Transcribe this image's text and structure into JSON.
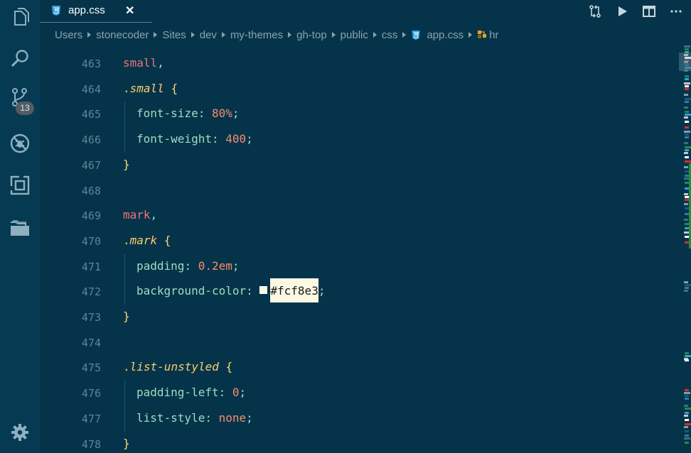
{
  "tabs": [
    {
      "label": "app.css",
      "close": "✕",
      "icon": "css3-icon"
    }
  ],
  "tab_actions": [
    "compare-changes-icon",
    "run-icon",
    "split-editor-icon",
    "more-actions-icon"
  ],
  "breadcrumb": [
    "Users",
    "stonecoder",
    "Sites",
    "dev",
    "my-themes",
    "gh-top",
    "public",
    "css",
    "app.css",
    "hr"
  ],
  "activity_bar": {
    "items": [
      "explorer-icon",
      "search-icon",
      "source-control-icon",
      "debug-icon",
      "extensions-icon",
      "folders-icon"
    ],
    "source_control_badge": "13",
    "settings": "settings-gear-icon"
  },
  "editor": {
    "lines": [
      {
        "num": "463",
        "kind": "selector",
        "text": "small",
        "tail": ","
      },
      {
        "num": "464",
        "kind": "class-open",
        "text": "small",
        "tail": " {"
      },
      {
        "num": "465",
        "kind": "decl",
        "prop": "font-size",
        "value": "80%"
      },
      {
        "num": "466",
        "kind": "decl",
        "prop": "font-weight",
        "value": "400"
      },
      {
        "num": "467",
        "kind": "close",
        "text": "}"
      },
      {
        "num": "468",
        "kind": "blank",
        "text": ""
      },
      {
        "num": "469",
        "kind": "selector",
        "text": "mark",
        "tail": ","
      },
      {
        "num": "470",
        "kind": "class-open",
        "text": "mark",
        "tail": " {"
      },
      {
        "num": "471",
        "kind": "decl",
        "prop": "padding",
        "value": "0.2em"
      },
      {
        "num": "472",
        "kind": "decl-color",
        "prop": "background-color",
        "value": "#fcf8e3"
      },
      {
        "num": "473",
        "kind": "close",
        "text": "}"
      },
      {
        "num": "474",
        "kind": "blank",
        "text": ""
      },
      {
        "num": "475",
        "kind": "class-open",
        "text": "list-unstyled",
        "tail": " {"
      },
      {
        "num": "476",
        "kind": "decl",
        "prop": "padding-left",
        "value": "0"
      },
      {
        "num": "477",
        "kind": "decl-kw",
        "prop": "list-style",
        "value": "none"
      },
      {
        "num": "478",
        "kind": "close",
        "text": "}"
      }
    ]
  },
  "colors": {
    "background": "#05344a",
    "activity_bar": "#063a52",
    "accent": "#2fa0e0",
    "swatch": "#fcf8e3"
  }
}
